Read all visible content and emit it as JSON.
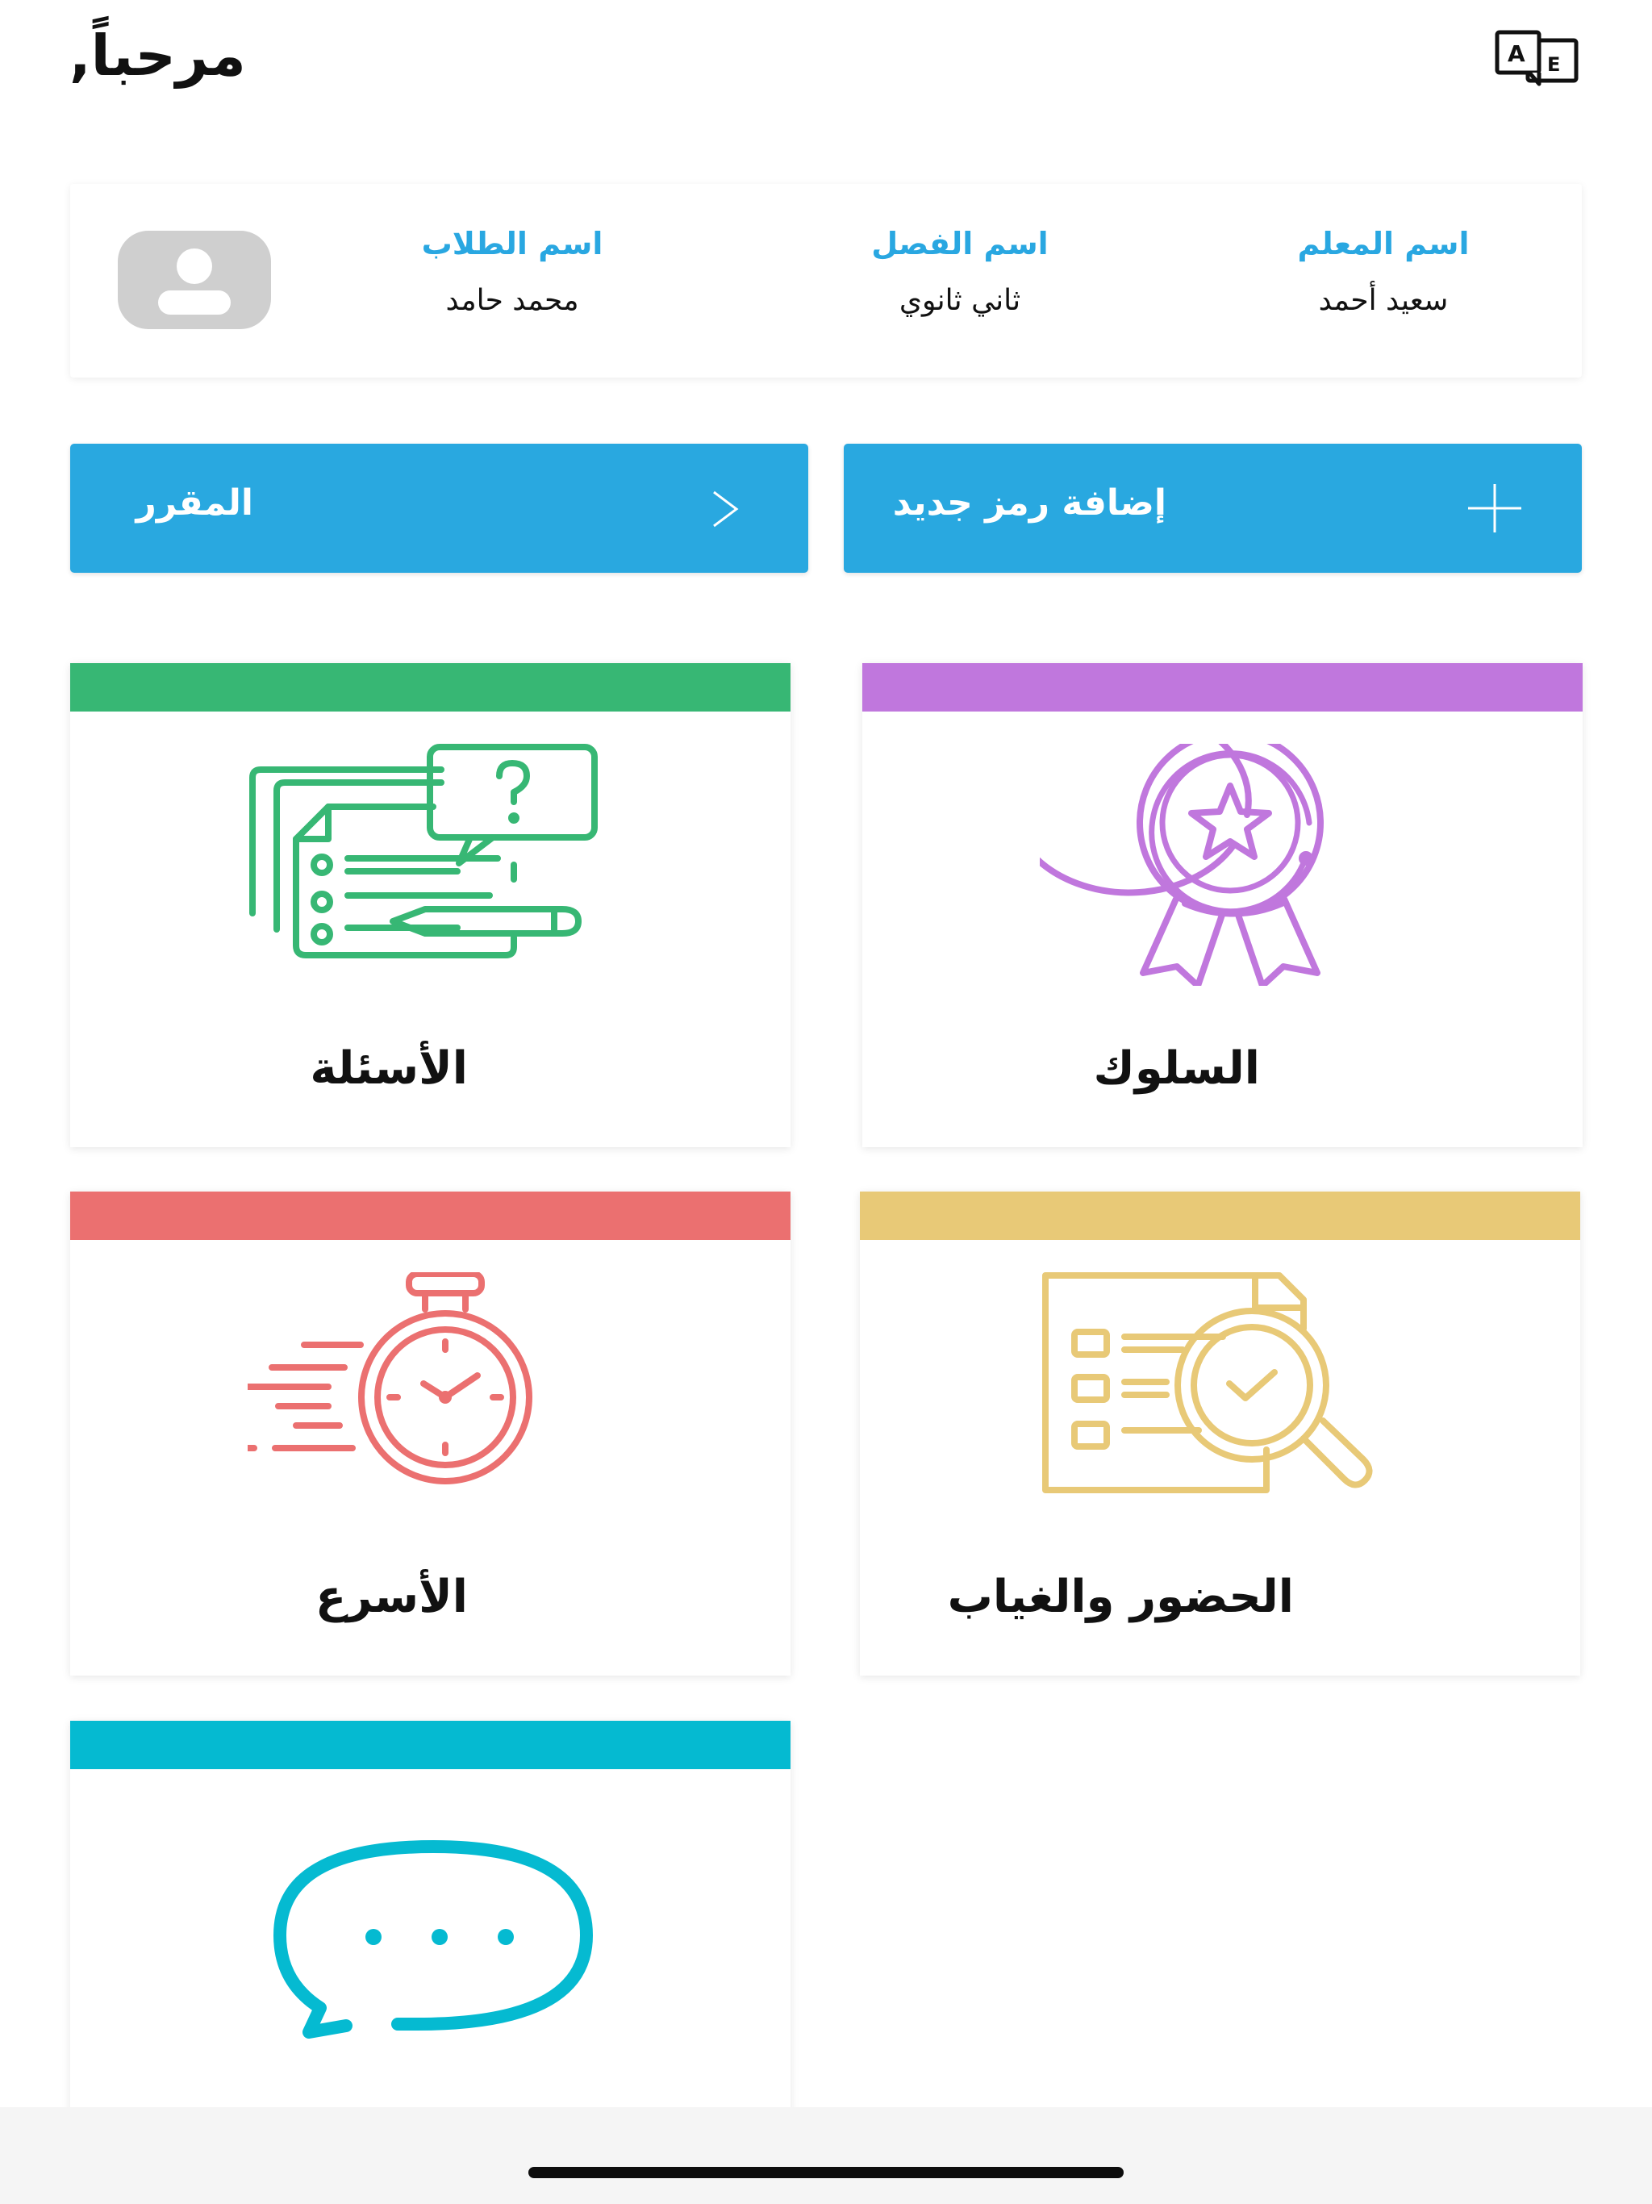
{
  "header": {
    "greeting": "مرحباً,",
    "language_icon": "translate-icon",
    "language_letters": [
      "A",
      "E"
    ]
  },
  "info": {
    "teacher": {
      "label": "اسم المعلم",
      "value": "سعيد أحمد"
    },
    "class": {
      "label": "اسم الفصل",
      "value": "ثاني ثانوي"
    },
    "student": {
      "label": "اسم الطلاب",
      "value": "محمد حامد"
    },
    "avatar_icon": "user-icon"
  },
  "actions": {
    "add_code": {
      "label": "إضافة رمز جديد",
      "icon": "plus-icon"
    },
    "course": {
      "label": "المقرر",
      "icon": "chevron-right-icon"
    }
  },
  "tiles": [
    {
      "title": "السلوك",
      "icon": "medal-icon",
      "color": "#c077dd"
    },
    {
      "title": "الأسئلة",
      "icon": "questions-icon",
      "color": "#37b774"
    },
    {
      "title": "الحضور والغياب",
      "icon": "attendance-icon",
      "color": "#e8c977"
    },
    {
      "title": "الأسرع",
      "icon": "stopwatch-icon",
      "color": "#eb7070"
    },
    {
      "title": "",
      "icon": "chat-icon",
      "color": "#05bad1"
    }
  ],
  "colors": {
    "accent": "#29a8e0",
    "avatar_bg": "#cfcfcf"
  }
}
